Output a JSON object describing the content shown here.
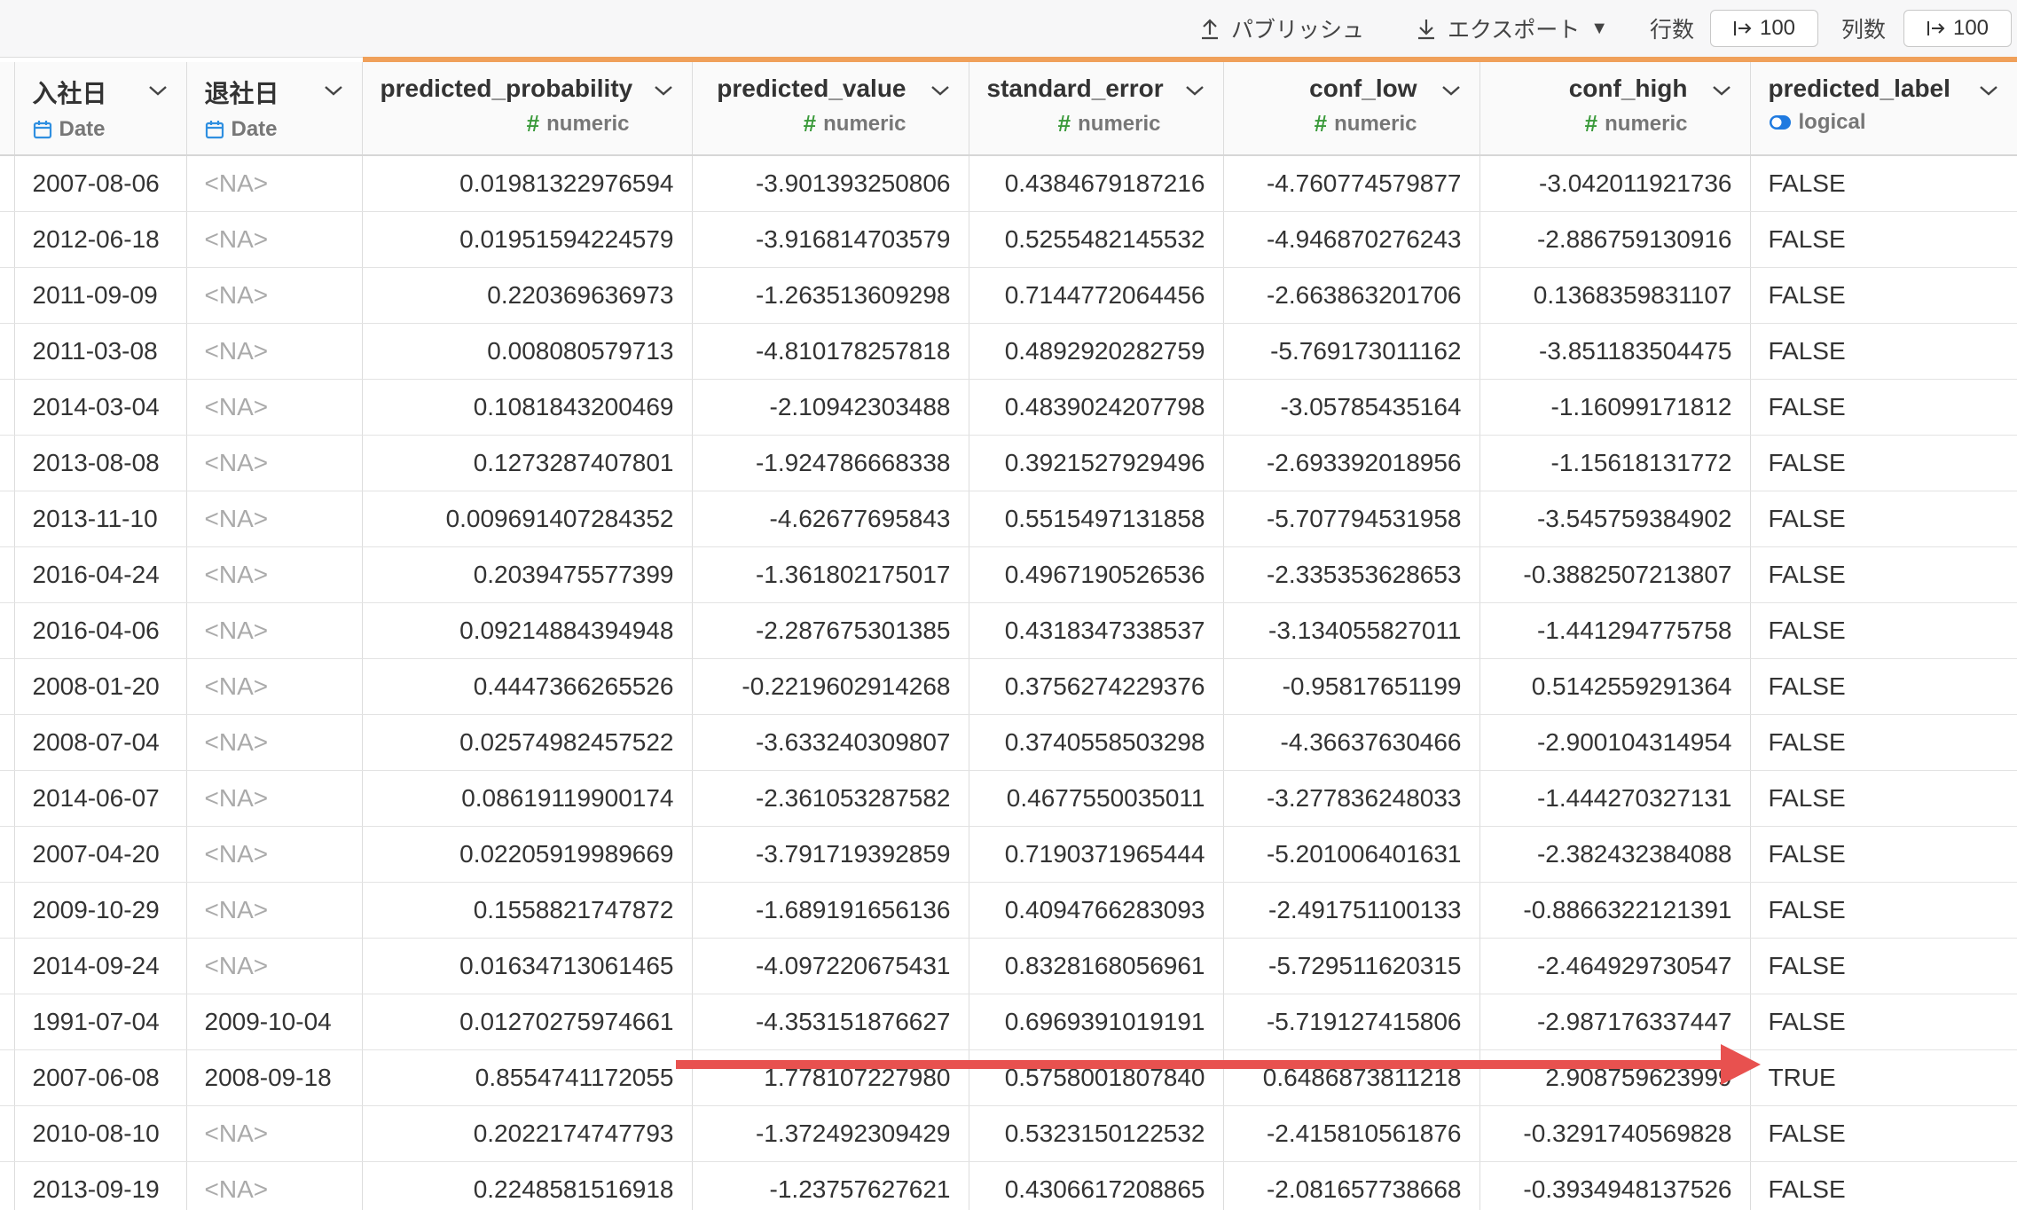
{
  "toolbar": {
    "publish_label": "パブリッシュ",
    "export_label": "エクスポート",
    "rows_label": "行数",
    "rows_value": "100",
    "cols_label": "列数",
    "cols_value": "100"
  },
  "columns": [
    {
      "name": "入社日",
      "type": "Date",
      "type_icon": "calendar-icon"
    },
    {
      "name": "退社日",
      "type": "Date",
      "type_icon": "calendar-icon"
    },
    {
      "name": "predicted_probability",
      "type": "numeric",
      "type_icon": "hash-icon"
    },
    {
      "name": "predicted_value",
      "type": "numeric",
      "type_icon": "hash-icon"
    },
    {
      "name": "standard_error",
      "type": "numeric",
      "type_icon": "hash-icon"
    },
    {
      "name": "conf_low",
      "type": "numeric",
      "type_icon": "hash-icon"
    },
    {
      "name": "conf_high",
      "type": "numeric",
      "type_icon": "hash-icon"
    },
    {
      "name": "predicted_label",
      "type": "logical",
      "type_icon": "toggle-icon"
    }
  ],
  "rows": [
    [
      "2007-08-06",
      "<NA>",
      "0.01981322976594",
      "-3.901393250806",
      "0.4384679187216",
      "-4.760774579877",
      "-3.042011921736",
      "FALSE"
    ],
    [
      "2012-06-18",
      "<NA>",
      "0.01951594224579",
      "-3.916814703579",
      "0.5255482145532",
      "-4.946870276243",
      "-2.886759130916",
      "FALSE"
    ],
    [
      "2011-09-09",
      "<NA>",
      "0.220369636973",
      "-1.263513609298",
      "0.7144772064456",
      "-2.663863201706",
      "0.1368359831107",
      "FALSE"
    ],
    [
      "2011-03-08",
      "<NA>",
      "0.008080579713",
      "-4.810178257818",
      "0.4892920282759",
      "-5.769173011162",
      "-3.851183504475",
      "FALSE"
    ],
    [
      "2014-03-04",
      "<NA>",
      "0.1081843200469",
      "-2.10942303488",
      "0.4839024207798",
      "-3.05785435164",
      "-1.16099171812",
      "FALSE"
    ],
    [
      "2013-08-08",
      "<NA>",
      "0.1273287407801",
      "-1.924786668338",
      "0.3921527929496",
      "-2.693392018956",
      "-1.15618131772",
      "FALSE"
    ],
    [
      "2013-11-10",
      "<NA>",
      "0.009691407284352",
      "-4.62677695843",
      "0.5515497131858",
      "-5.707794531958",
      "-3.545759384902",
      "FALSE"
    ],
    [
      "2016-04-24",
      "<NA>",
      "0.2039475577399",
      "-1.361802175017",
      "0.4967190526536",
      "-2.335353628653",
      "-0.3882507213807",
      "FALSE"
    ],
    [
      "2016-04-06",
      "<NA>",
      "0.09214884394948",
      "-2.287675301385",
      "0.4318347338537",
      "-3.134055827011",
      "-1.441294775758",
      "FALSE"
    ],
    [
      "2008-01-20",
      "<NA>",
      "0.4447366265526",
      "-0.2219602914268",
      "0.3756274229376",
      "-0.95817651199",
      "0.5142559291364",
      "FALSE"
    ],
    [
      "2008-07-04",
      "<NA>",
      "0.02574982457522",
      "-3.633240309807",
      "0.3740558503298",
      "-4.36637630466",
      "-2.900104314954",
      "FALSE"
    ],
    [
      "2014-06-07",
      "<NA>",
      "0.08619119900174",
      "-2.361053287582",
      "0.4677550035011",
      "-3.277836248033",
      "-1.444270327131",
      "FALSE"
    ],
    [
      "2007-04-20",
      "<NA>",
      "0.02205919989669",
      "-3.791719392859",
      "0.7190371965444",
      "-5.201006401631",
      "-2.382432384088",
      "FALSE"
    ],
    [
      "2009-10-29",
      "<NA>",
      "0.1558821747872",
      "-1.689191656136",
      "0.4094766283093",
      "-2.491751100133",
      "-0.8866322121391",
      "FALSE"
    ],
    [
      "2014-09-24",
      "<NA>",
      "0.01634713061465",
      "-4.097220675431",
      "0.8328168056961",
      "-5.729511620315",
      "-2.464929730547",
      "FALSE"
    ],
    [
      "1991-07-04",
      "2009-10-04",
      "0.01270275974661",
      "-4.353151876627",
      "0.6969391019191",
      "-5.719127415806",
      "-2.987176337447",
      "FALSE"
    ],
    [
      "2007-06-08",
      "2008-09-18",
      "0.8554741172055",
      "1.778107227980",
      "0.5758001807840",
      "0.6486873811218",
      "2.908759623999",
      "TRUE"
    ],
    [
      "2010-08-10",
      "<NA>",
      "0.2022174747793",
      "-1.372492309429",
      "0.5323150122532",
      "-2.415810561876",
      "-0.3291740569828",
      "FALSE"
    ],
    [
      "2013-09-19",
      "<NA>",
      "0.2248581516918",
      "-1.23757627621",
      "0.4306617208865",
      "-2.081657738668",
      "-0.3934948137526",
      "FALSE"
    ]
  ],
  "colors": {
    "active_header_accent": "#f0a05a",
    "annotation_arrow": "#e8514f",
    "numeric_icon": "#3a9a3a",
    "date_icon": "#2f8fe0",
    "logical_icon": "#1f7ae0"
  }
}
